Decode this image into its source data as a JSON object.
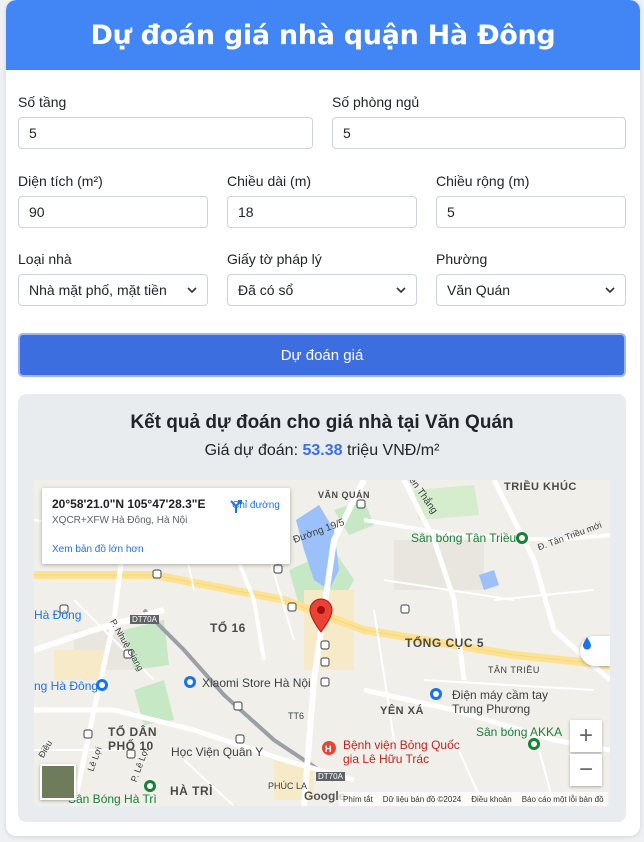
{
  "header": {
    "title": "Dự đoán giá nhà quận Hà Đông"
  },
  "form": {
    "floors": {
      "label": "Số tầng",
      "value": "5"
    },
    "bedrooms": {
      "label": "Số phòng ngủ",
      "value": "5"
    },
    "area": {
      "label": "Diện tích (m²)",
      "value": "90"
    },
    "length": {
      "label": "Chiều dài (m)",
      "value": "18"
    },
    "width": {
      "label": "Chiều rộng (m)",
      "value": "5"
    },
    "house_type": {
      "label": "Loại nhà",
      "value": "Nhà mặt phố, mặt tiền"
    },
    "legal": {
      "label": "Giấy tờ pháp lý",
      "value": "Đã có sổ"
    },
    "ward": {
      "label": "Phường",
      "value": "Văn Quán"
    },
    "submit_label": "Dự đoán giá"
  },
  "result": {
    "title_prefix": "Kết quả dự đoán cho giá nhà tại",
    "ward": "Văn Quán",
    "price_prefix": "Giá dự đoán:",
    "price_value": "53.38",
    "price_unit": "triệu VNĐ/m²"
  },
  "map": {
    "coords": "20°58'21.0\"N 105°47'28.3\"E",
    "plus_code": "XQCR+XFW Hà Đông, Hà Nội",
    "directions_label": "Chỉ đường",
    "larger_map_label": "Xem bản đồ lớn hơn",
    "labels": {
      "van_quan": "VĂN QUÁN",
      "trieu_khuc": "TRIỀU KHÚC",
      "chien_thang": "Chiến Thắng",
      "duong_19_5": "Đường 19/5",
      "san_bong_tan_trieu": "Sân bóng Tân Triều",
      "d_tan_trieu_moi": "Đ. Tân Triều mới",
      "to_16": "TỔ 16",
      "tong_cuc_5": "TỔNG CỤC 5",
      "tan_trieu": "TÂN TRIỀU",
      "dt70a": "DT70A",
      "p_nhue_giang": "P. Nhuệ Giang",
      "xiaomi": "Xiaomi Store Hà Nội",
      "ha_dong_left": "Hà Đông",
      "ng_ha_dong": "ng Hà Đông",
      "dien_may": "Điện máy cầm tay",
      "trung_phuong": "Trung Phương",
      "yen_xa": "YÊN XÁ",
      "san_bong_akka": "Sân bóng AKKA",
      "to_dan_pho_10_a": "TỔ DÂN",
      "to_dan_pho_10_b": "PHỐ 10",
      "hoc_vien": "Học Viện Quân Y",
      "benh_vien_1": "Bệnh viện Bỏng Quốc",
      "benh_vien_2": "gia Lê Hữu Trác",
      "ha_tri": "HÀ TRÌ",
      "san_bong_ha_tri": "Sân Bóng Hà Trì",
      "phuc_la": "PHÚC LA",
      "dieu": "Điều",
      "le_loi_a": "Lê Lợi",
      "le_loi_b": "P. Lê Lợi",
      "tt6": "TT6",
      "dt70a_2": "DT70A"
    },
    "google": "Google",
    "footer": [
      "Phím tắt",
      "Dữ liệu bản đồ ©2024",
      "Điều khoản",
      "Báo cáo một lỗi bản đồ"
    ],
    "zoom_in": "+",
    "zoom_out": "−"
  },
  "colors": {
    "header": "#4285f4",
    "button": "#3d6ee0",
    "price": "#3d6ee0",
    "pin": "#ea4335"
  }
}
